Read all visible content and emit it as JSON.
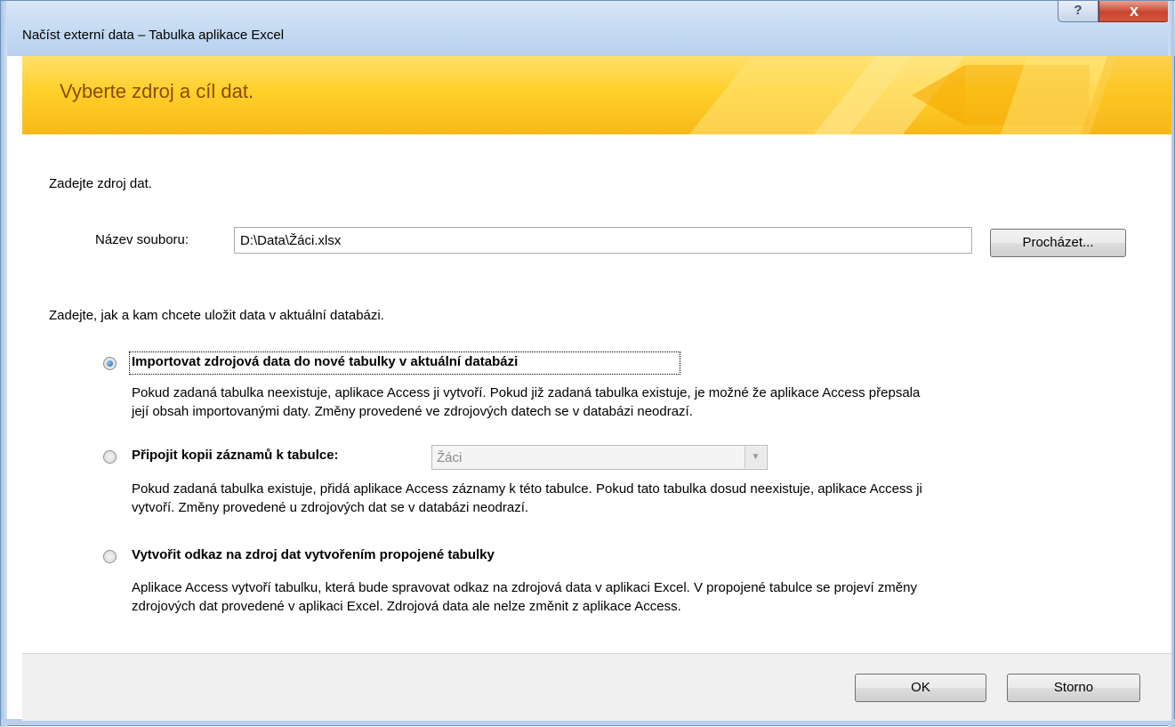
{
  "window": {
    "title": "Načíst externí data – Tabulka aplikace Excel",
    "help_label": "?",
    "close_label": "x"
  },
  "banner": {
    "title": "Vyberte zdroj a cíl dat."
  },
  "source": {
    "heading": "Zadejte zdroj dat.",
    "file_label": "Název souboru:",
    "file_value": "D:\\Data\\Žáci.xlsx",
    "browse_label": "Procházet..."
  },
  "destination": {
    "heading": "Zadejte, jak a kam chcete uložit data v aktuální databázi.",
    "options": [
      {
        "label": "Importovat zdrojová data do nové tabulky v aktuální databázi",
        "selected": true,
        "desc1": "Pokud zadaná tabulka neexistuje, aplikace Access ji vytvoří. Pokud již zadaná tabulka existuje, je možné že aplikace Access přepsala",
        "desc2": "její obsah importovanými daty. Změny provedené ve zdrojových datech se v databázi neodrazí."
      },
      {
        "label": "Připojit kopii záznamů k tabulce:",
        "selected": false,
        "combo_value": "Žáci",
        "desc1": "Pokud zadaná tabulka existuje, přidá aplikace Access záznamy k této tabulce. Pokud tato tabulka dosud neexistuje, aplikace Access ji",
        "desc2": "vytvoří. Změny provedené u zdrojových dat se v databázi neodrazí."
      },
      {
        "label": "Vytvořit odkaz na zdroj dat vytvořením propojené tabulky",
        "selected": false,
        "desc1": "Aplikace Access vytvoří tabulku, která bude spravovat odkaz na zdrojová data v aplikaci Excel. V propojené tabulce se projeví změny",
        "desc2": "zdrojových dat provedené v aplikaci Excel. Zdrojová data ale nelze změnit z aplikace Access."
      }
    ]
  },
  "footer": {
    "ok_label": "OK",
    "cancel_label": "Storno"
  },
  "colors": {
    "banner_yellow": "#ffd02a",
    "banner_text": "#8a4b00",
    "close_red": "#c8452f"
  }
}
